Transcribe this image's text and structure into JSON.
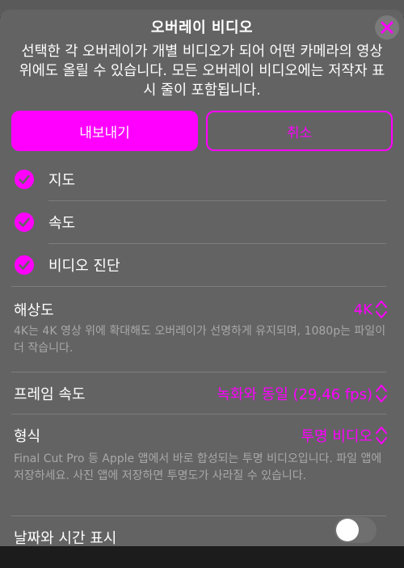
{
  "modal": {
    "title": "오버레이 비디오",
    "description": "선택한 각 오버레이가 개별 비디오가 되어 어떤 카메라의 영상 위에도 올릴 수 있습니다. 모든 오버레이 비디오에는 저작자 표시 줄이 포함됩니다.",
    "close_icon": "close-icon",
    "accent_color": "#ff00ff"
  },
  "buttons": {
    "export_label": "내보내기",
    "cancel_label": "취소"
  },
  "overlays": [
    {
      "label": "지도",
      "checked": true
    },
    {
      "label": "속도",
      "checked": true
    },
    {
      "label": "비디오 진단",
      "checked": true
    }
  ],
  "settings": {
    "resolution": {
      "label": "해상도",
      "value": "4K",
      "description": "4K는 4K 영상 위에 확대해도 오버레이가 선명하게 유지되며, 1080p는 파일이 더 작습니다."
    },
    "frame_rate": {
      "label": "프레임 속도",
      "value": "녹화와 동일 (29,46 fps)"
    },
    "format": {
      "label": "형식",
      "value": "투명 비디오",
      "description": "Final Cut Pro 등 Apple 앱에서 바로 합성되는 투명 비디오입니다. 파일 앱에 저장하세요. 사진 앱에 저장하면 투명도가 사라질 수 있습니다."
    },
    "time_display": {
      "label": "날짜와 시간 표시",
      "enabled": false
    }
  }
}
